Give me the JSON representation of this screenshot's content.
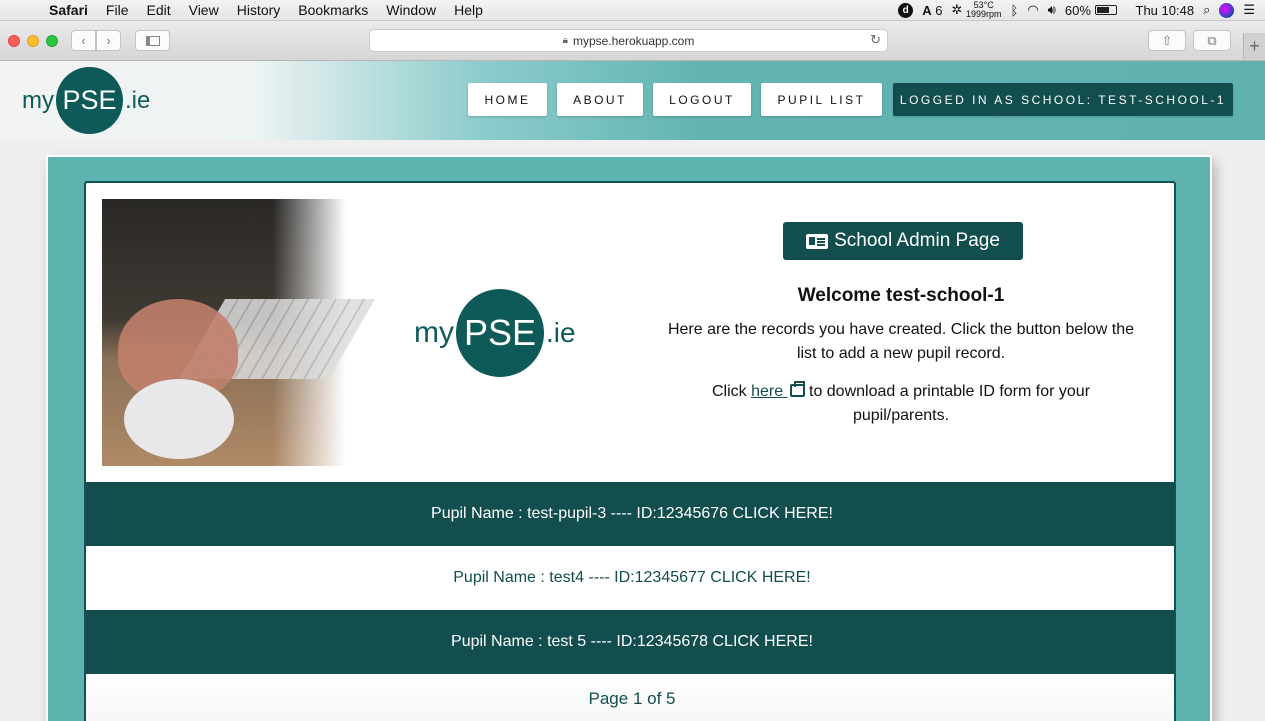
{
  "menubar": {
    "app": "Safari",
    "items": [
      "File",
      "Edit",
      "View",
      "History",
      "Bookmarks",
      "Window",
      "Help"
    ],
    "status": {
      "d_icon": "d",
      "adobe_count": "6",
      "temp": "53°C",
      "rpm": "1999rpm",
      "battery": "60%",
      "clock": "Thu 10:48"
    }
  },
  "browser": {
    "url": "mypse.herokuapp.com"
  },
  "header": {
    "logo": {
      "my": "my",
      "pse": "PSE",
      "ie": ".ie"
    },
    "nav": [
      "HOME",
      "ABOUT",
      "LOGOUT",
      "PUPIL LIST"
    ],
    "logged_in": "LOGGED IN AS SCHOOL: TEST-SCHOOL-1"
  },
  "main": {
    "admin_button": "School Admin Page",
    "welcome": "Welcome test-school-1",
    "intro": "Here are the records you have created. Click the button below the list to add a new pupil record.",
    "download_prefix": "Click ",
    "download_link": "here",
    "download_suffix": " to download a printable ID form for your pupil/parents.",
    "pupils": [
      "Pupil Name : test-pupil-3 ---- ID:12345676 CLICK HERE!",
      "Pupil Name : test4 ---- ID:12345677 CLICK HERE!",
      "Pupil Name : test 5 ---- ID:12345678 CLICK HERE!"
    ],
    "pager": "Page 1 of 5"
  },
  "colors": {
    "brand_dark": "#124e4e",
    "teal": "#5eb3b0"
  }
}
